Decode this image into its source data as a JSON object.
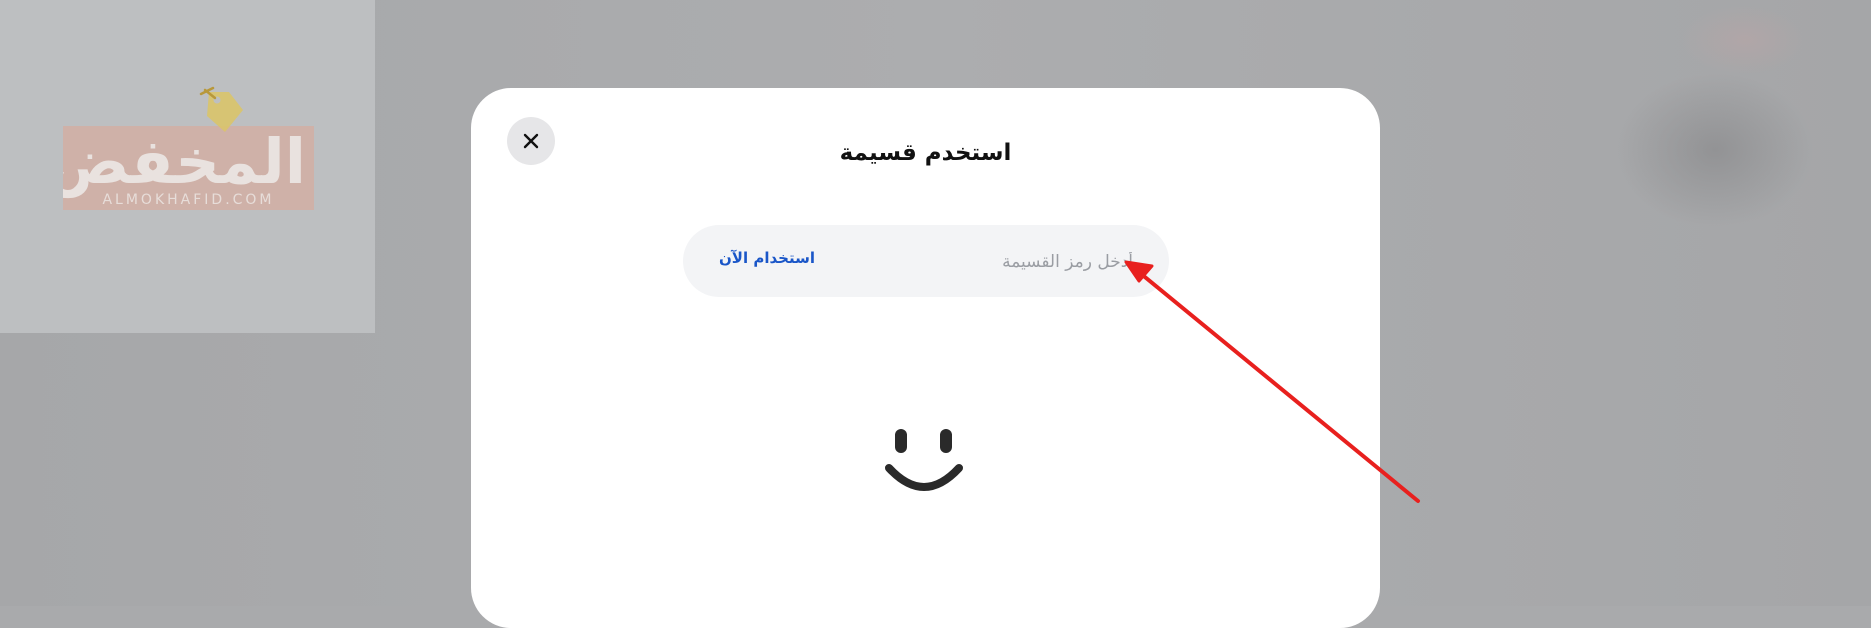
{
  "background": {
    "logo": {
      "arabic_name": "المخفض",
      "domain": "ALMOKHAFID.COM",
      "icon": "price-tag-icon"
    }
  },
  "modal": {
    "title": "استخدم قسيمة",
    "close_icon": "close-icon",
    "coupon_field": {
      "placeholder": "أدخل رمز القسيمة",
      "value": ""
    },
    "apply_label": "استخدام الآن",
    "illustration_icon": "smile-icon"
  },
  "colors": {
    "accent_link": "#1a56c8",
    "annotation_arrow": "#e8201e",
    "modal_background": "#ffffff",
    "input_background": "#f3f4f6"
  }
}
